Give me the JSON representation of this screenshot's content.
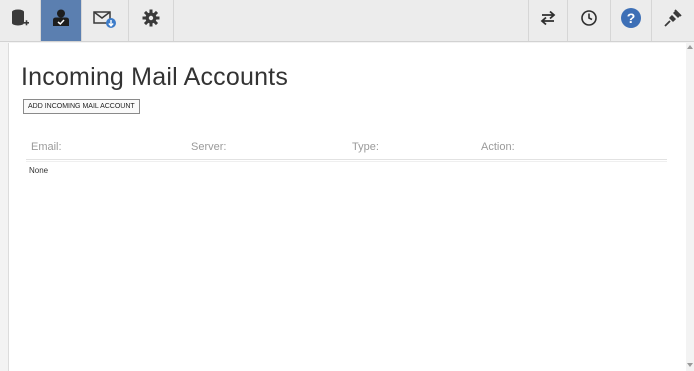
{
  "toolbar": {
    "left_icons": [
      "database-add-icon",
      "user-account-icon",
      "mail-download-icon",
      "gear-icon"
    ],
    "right_icons": [
      "sync-arrows-icon",
      "clock-icon",
      "help-icon",
      "plug-icon"
    ],
    "active_index": 1,
    "accent_color": "#5b7fb0",
    "help_color": "#3d6fb6"
  },
  "main": {
    "title": "Incoming Mail Accounts",
    "add_button_label": "ADD INCOMING MAIL ACCOUNT",
    "columns": [
      "Email:",
      "Server:",
      "Type:",
      "Action:"
    ],
    "empty_text": "None"
  }
}
